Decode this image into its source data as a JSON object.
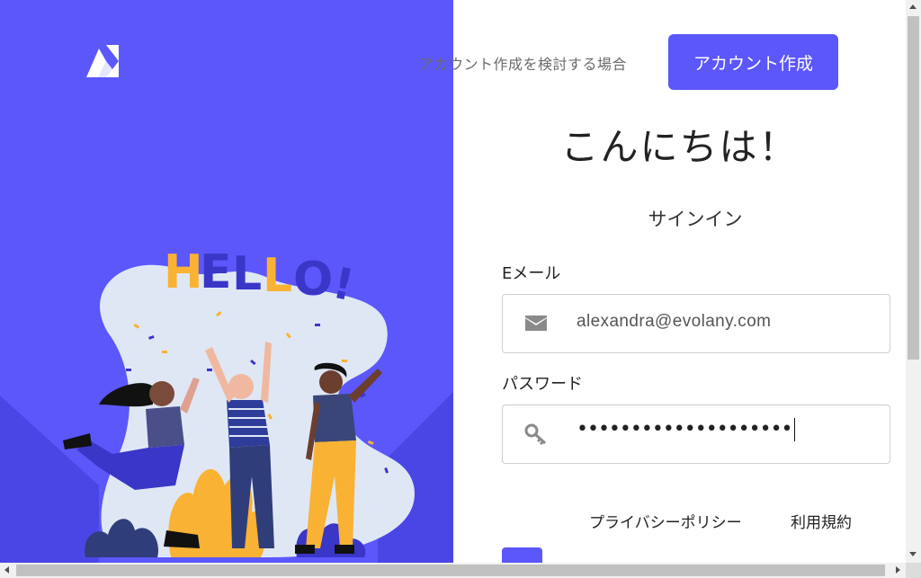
{
  "header": {
    "prompt_text": "アカウント作成を検討する場合",
    "create_account_label": "アカウント作成"
  },
  "main": {
    "greeting": "こんにちは！",
    "signin_title": "サインイン",
    "email_label": "Eメール",
    "email_value": "alexandra@evolany.com",
    "password_label": "パスワード",
    "password_value": "••••••••••••••••••••"
  },
  "footer_links": {
    "privacy": "プライバシーポリシー",
    "terms": "利用規約"
  },
  "illustration": {
    "hello_text": "HELLO!"
  },
  "colors": {
    "brand": "#5b57fb",
    "accent_yellow": "#f9b233",
    "blob": "#dfe7f5"
  },
  "icons": {
    "logo": "brand-logo",
    "email": "envelope-icon",
    "password": "key-icon"
  }
}
